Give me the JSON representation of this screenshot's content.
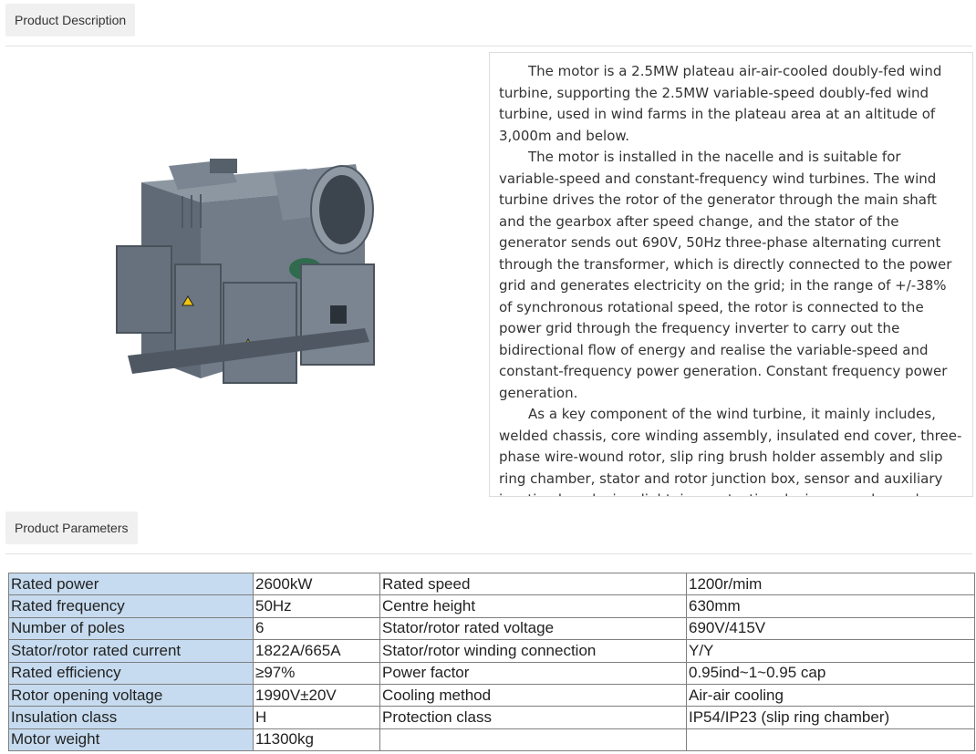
{
  "tabs": {
    "description": "Product Description",
    "parameters": "Product Parameters"
  },
  "description": {
    "paragraphs": [
      "The motor is a 2.5MW plateau air-air-cooled doubly-fed wind turbine, supporting the 2.5MW variable-speed doubly-fed wind turbine, used in wind farms in the plateau area at an altitude of 3,000m and below.",
      "The motor is installed in the nacelle and is suitable for variable-speed and constant-frequency wind turbines. The wind turbine drives the rotor of the generator through the main shaft and the gearbox after speed change, and the stator of the generator sends out 690V, 50Hz three-phase alternating current through the transformer, which is directly connected to the power grid and generates electricity on the grid; in the range of +/-38% of synchronous rotational speed, the rotor is connected to the power grid through the frequency inverter to carry out the bidirectional flow of energy and realise the variable-speed and constant-frequency power generation. Constant frequency power generation.",
      "As a key component of the wind turbine, it mainly includes, welded chassis, core winding assembly, insulated end cover, three-phase wire-wound rotor, slip ring brush holder assembly and slip ring chamber, stator and rotor junction box, sensor and auxiliary junction box device, lightning protection device, encoder and so on."
    ]
  },
  "parameters": {
    "rows": [
      [
        "Rated power",
        "2600kW",
        "Rated speed",
        "1200r/mim"
      ],
      [
        "Rated frequency",
        "50Hz",
        "Centre height",
        "630mm"
      ],
      [
        "Number of poles",
        "6",
        "Stator/rotor rated voltage",
        "690V/415V"
      ],
      [
        "Stator/rotor rated current",
        "1822A/665A",
        "Stator/rotor winding connection",
        "Y/Y"
      ],
      [
        "Rated efficiency",
        "≥97%",
        "Power factor",
        "0.95ind~1~0.95 cap"
      ],
      [
        "Rotor opening voltage",
        "1990V±20V",
        "Cooling method",
        "Air-air cooling"
      ],
      [
        "Insulation class",
        "H",
        "Protection class",
        "IP54/IP23 (slip ring chamber)"
      ],
      [
        "Motor weight",
        "11300kg",
        "",
        ""
      ]
    ]
  },
  "colors": {
    "label_cell": "#c6dbef",
    "tab_bg": "#f0f0f0",
    "motor_body": "#6f7a86"
  }
}
